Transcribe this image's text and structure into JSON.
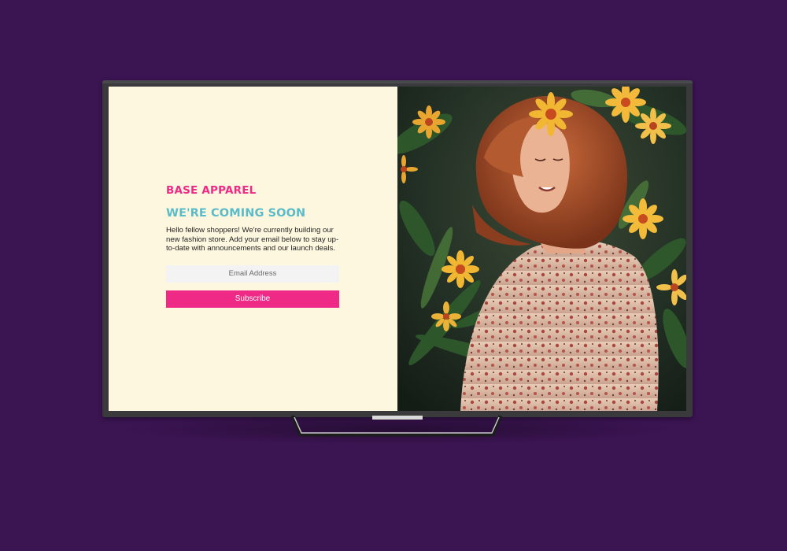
{
  "brand": {
    "name": "BASE APPAREL"
  },
  "hero": {
    "headline": "WE'RE COMING SOON",
    "description": "Hello fellow shoppers! We're currently building our new fashion store. Add your email below to stay up-to-date with announcements and our launch deals."
  },
  "form": {
    "email_placeholder": "Email Address",
    "subscribe_label": "Subscribe"
  },
  "colors": {
    "background": "#3b1452",
    "panel": "#fef7df",
    "brand": "#ef2a86",
    "headline": "#5bbcc9",
    "button": "#ef2a86"
  },
  "image": {
    "subject": "woman-with-flowers-photo"
  }
}
